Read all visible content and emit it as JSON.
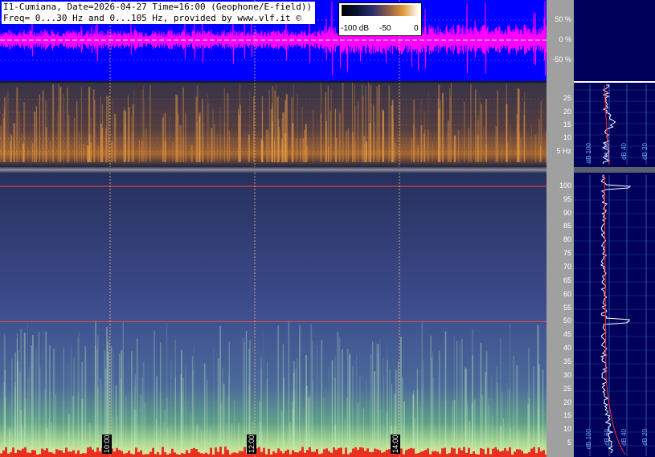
{
  "header": {
    "title_line1": "I1-Cumiana, Date=2026-04-27 Time=16:00 (Geophone/E-field))",
    "title_line2": "Freq= 0...30 Hz and 0...105 Hz, provided by www.vlf.it ©"
  },
  "color_scale": {
    "labels": [
      "-100 dB",
      "-50",
      "0"
    ],
    "colors": [
      "#000000",
      "#2b2f6c",
      "#e39a3a",
      "#ffffff"
    ]
  },
  "chart_data": [
    {
      "type": "line",
      "name": "waveform",
      "yticks": [
        "50 %",
        "0 %",
        "-50 %"
      ],
      "ytick_values": [
        50,
        0,
        -50
      ],
      "ylim": [
        -100,
        100
      ],
      "colors": {
        "background": "#0000ff",
        "trace": "#ff00ff"
      }
    },
    {
      "type": "heatmap",
      "name": "low-frequency-spectrogram",
      "yticks": [
        "25",
        "20",
        "15",
        "10",
        "5 Hz"
      ],
      "ytick_values": [
        25,
        20,
        15,
        10,
        5
      ],
      "ylim": [
        0,
        30
      ],
      "colors": {
        "low": "#1b2040",
        "high": "#f0a040"
      }
    },
    {
      "type": "heatmap",
      "name": "high-frequency-spectrogram",
      "yticks": [
        "100",
        "95",
        "90",
        "85",
        "80",
        "75",
        "70",
        "65",
        "60",
        "55",
        "50",
        "45",
        "40",
        "35",
        "30",
        "25",
        "20",
        "15",
        "10",
        "5"
      ],
      "ytick_values": [
        100,
        95,
        90,
        85,
        80,
        75,
        70,
        65,
        60,
        55,
        50,
        45,
        40,
        35,
        30,
        25,
        20,
        15,
        10,
        5
      ],
      "ylim": [
        0,
        105
      ],
      "marked_lines": [
        100,
        50
      ],
      "time_markers": [
        "10:00",
        "12:00",
        "14:00"
      ],
      "colors": {
        "background": "#3c4a8c",
        "low_band": "#6cc080",
        "marker_line": "#ff4040"
      }
    },
    {
      "type": "line",
      "name": "side-spectrum-low",
      "x_labels": [
        "dB 100",
        "dB 60",
        "dB 40",
        "dB 20"
      ],
      "colors": {
        "trace": "#ffffff",
        "fit": "#ff3030",
        "grid": "#4a90d9"
      }
    },
    {
      "type": "line",
      "name": "side-spectrum-high",
      "x_labels": [
        "dB 100",
        "dB 60",
        "dB 40",
        "dB 20"
      ],
      "colors": {
        "trace": "#ffffff",
        "fit": "#ff3030",
        "grid": "#4a90d9"
      }
    }
  ]
}
